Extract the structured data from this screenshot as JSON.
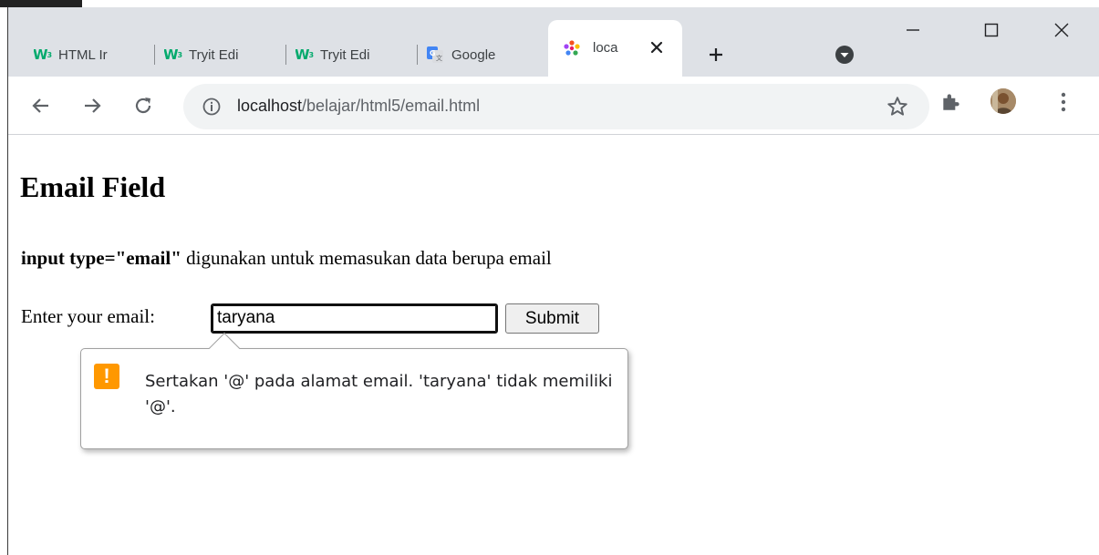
{
  "browser": {
    "tabs": [
      {
        "label": "HTML Ir",
        "icon": "w3schools-icon"
      },
      {
        "label": "Tryit Edi",
        "icon": "w3schools-icon"
      },
      {
        "label": "Tryit Edi",
        "icon": "w3schools-icon"
      },
      {
        "label": "Google",
        "icon": "google-translate-icon"
      },
      {
        "label": "loca",
        "icon": "localhost-icon",
        "active": true
      }
    ],
    "w3_logo": "W",
    "w3_sup": "3",
    "new_tab_label": "+",
    "address": {
      "host": "localhost",
      "path": "/belajar/html5/email.html"
    }
  },
  "page": {
    "heading": "Email Field",
    "desc_bold": "input type=\"email\"",
    "desc_rest": " digunakan untuk memasukan data berupa email",
    "label": "Enter your email:",
    "input_value": "taryana",
    "submit_label": "Submit"
  },
  "validation": {
    "icon": "!",
    "message": "Sertakan '@' pada alamat email. 'taryana' tidak memiliki '@'."
  },
  "colors": {
    "accent_warning": "#ff9800",
    "w3_green": "#04aa6d",
    "chrome_frame": "#dee1e6"
  }
}
